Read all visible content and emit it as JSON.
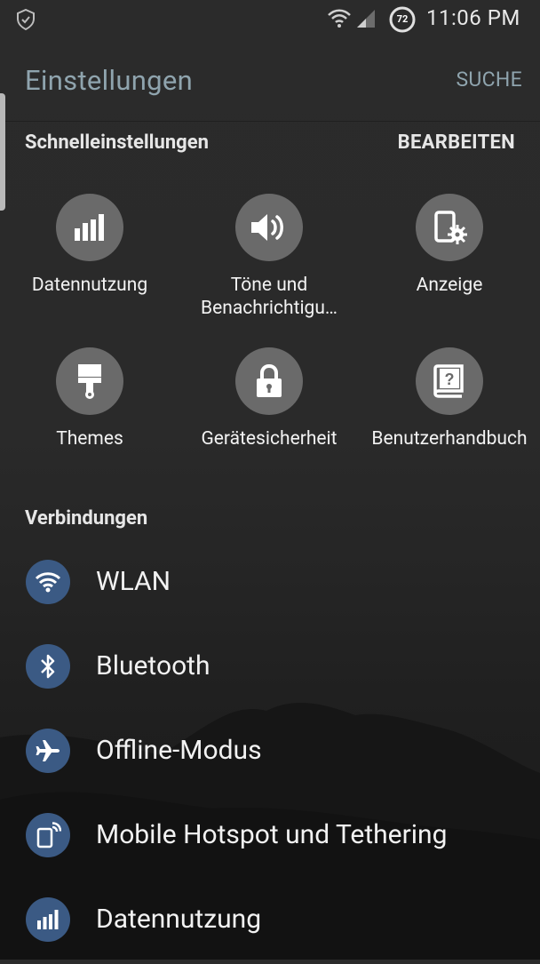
{
  "status_bar": {
    "time": "11:06 PM",
    "battery_level": "72",
    "icons": [
      "shield-check-icon",
      "wifi-icon",
      "cell-signal-icon",
      "battery-icon"
    ]
  },
  "app_bar": {
    "title": "Einstellungen",
    "search_label": "SUCHE"
  },
  "quick_settings": {
    "header": "Schnelleinstellungen",
    "edit_label": "BEARBEITEN",
    "items": [
      {
        "label": "Datennutzung",
        "icon": "data-usage-icon"
      },
      {
        "label": "Töne und Benachrichtigu…",
        "icon": "sound-icon"
      },
      {
        "label": "Anzeige",
        "icon": "display-settings-icon"
      },
      {
        "label": "Themes",
        "icon": "paint-brush-icon"
      },
      {
        "label": "Gerätesicherheit",
        "icon": "lock-icon"
      },
      {
        "label": "Benutzerhandbuch",
        "icon": "user-manual-icon"
      }
    ]
  },
  "connections": {
    "header": "Verbindungen",
    "items": [
      {
        "label": "WLAN",
        "icon": "wifi-icon"
      },
      {
        "label": "Bluetooth",
        "icon": "bluetooth-icon"
      },
      {
        "label": "Offline-Modus",
        "icon": "airplane-icon"
      },
      {
        "label": "Mobile Hotspot und Tethering",
        "icon": "hotspot-icon"
      },
      {
        "label": "Datennutzung",
        "icon": "data-usage-icon"
      }
    ]
  },
  "colors": {
    "accent_title": "#8fa4ae",
    "quick_circle": "#6a6a6a",
    "list_circle": "#3b5a84"
  }
}
